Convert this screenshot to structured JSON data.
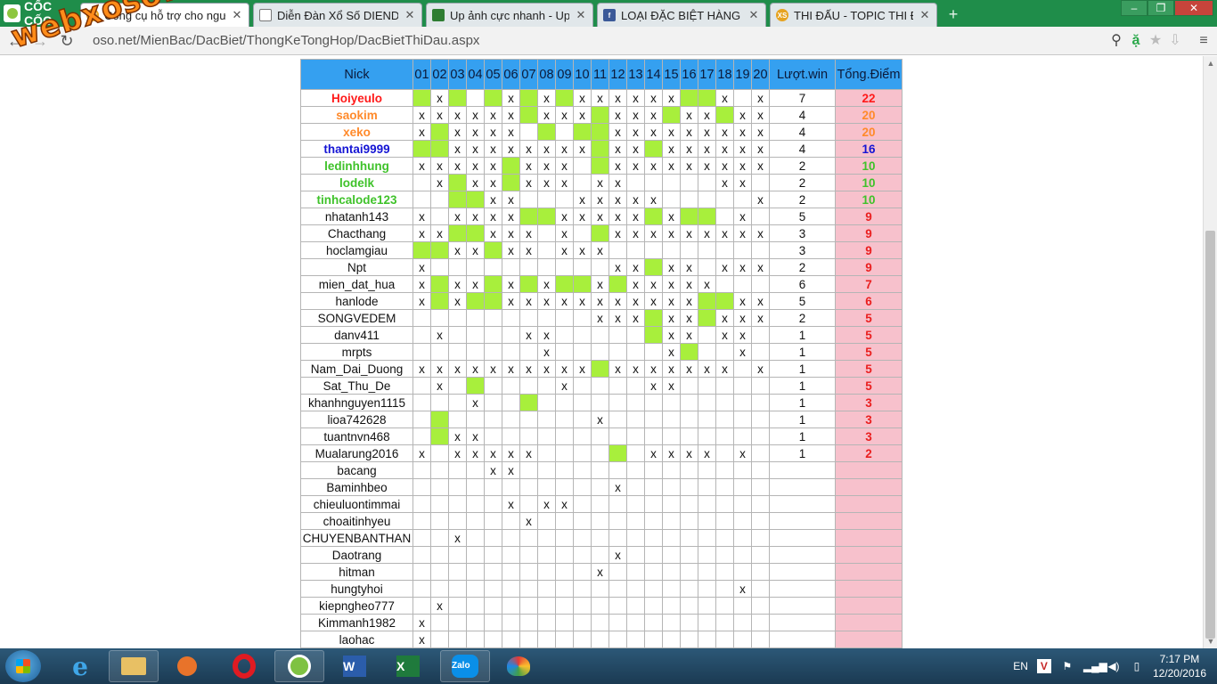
{
  "browser": {
    "brand": "CỐC CỐC",
    "tabs": [
      {
        "title": "Công cụ hỗ trợ cho người",
        "icon": "xs",
        "active": true
      },
      {
        "title": "Diễn Đàn Xổ Số DIENDAN",
        "icon": "doc",
        "active": false
      },
      {
        "title": "Up ảnh cực nhanh - Up hì",
        "icon": "img",
        "active": false
      },
      {
        "title": "LOẠI ĐẶC BIỆT HÀNG NGÀ",
        "icon": "fb",
        "active": false
      },
      {
        "title": "THI ĐẤU - TOPIC THI ĐẤU",
        "icon": "xs",
        "active": false
      }
    ],
    "url": "oso.net/MienBac/DacBiet/ThongKeTongHop/DacBietThiDau.aspx",
    "new_tab_label": "+",
    "window_controls": {
      "minimize": "–",
      "restore": "❐",
      "close": "✕"
    }
  },
  "watermark": "webxoso.net",
  "table": {
    "headers": {
      "nick": "Nick",
      "days": [
        "01",
        "02",
        "03",
        "04",
        "05",
        "06",
        "07",
        "08",
        "09",
        "10",
        "11",
        "12",
        "13",
        "14",
        "15",
        "16",
        "17",
        "18",
        "19",
        "20"
      ],
      "wins": "Lượt.win",
      "points": "Tổng.Điểm"
    },
    "rows": [
      {
        "nick": "Hoiyeulo",
        "color": "red",
        "cells": "GxG-GxGxGxxxxxxGGx-x",
        "wins": "7",
        "points": "22"
      },
      {
        "nick": "saokim",
        "color": "orange",
        "cells": "xxxxxxGxxxGxxxGxxGxx",
        "wins": "4",
        "points": "20"
      },
      {
        "nick": "xeko",
        "color": "orange",
        "cells": "xGxxxx-G-GGxxxxxxxxx",
        "wins": "4",
        "points": "20"
      },
      {
        "nick": "thantai9999",
        "color": "blue",
        "cells": "GGxxxxxxxxGxxGxxxxxx",
        "wins": "4",
        "points": "16"
      },
      {
        "nick": "ledinhhung",
        "color": "green",
        "cells": "xxxxxGxxx-Gxxxxxxxxx",
        "wins": "2",
        "points": "10"
      },
      {
        "nick": "lodelk",
        "color": "green",
        "cells": "-xGxxGxxx-xx-----xx-",
        "wins": "2",
        "points": "10"
      },
      {
        "nick": "tinhcalode123",
        "color": "green",
        "cells": "--GGxx---xxxxx-----x",
        "wins": "2",
        "points": "10"
      },
      {
        "nick": "nhatanh143",
        "color": "default",
        "cells": "x-xxxxGGxxxxxGxGG-x-",
        "wins": "5",
        "points": "9"
      },
      {
        "nick": "Chacthang",
        "color": "default",
        "cells": "xxGGxxx-x-Gxxxxxxxxx",
        "wins": "3",
        "points": "9"
      },
      {
        "nick": "hoclamgiau",
        "color": "default",
        "cells": "GGxxGxx-xxx---------",
        "wins": "3",
        "points": "9"
      },
      {
        "nick": "Npt",
        "color": "default",
        "cells": "x----------xxGxx-xxx",
        "wins": "2",
        "points": "9"
      },
      {
        "nick": "mien_dat_hua",
        "color": "default",
        "cells": "xGxxGxGxGGxGxxxxx---",
        "wins": "6",
        "points": "7"
      },
      {
        "nick": "hanlode",
        "color": "default",
        "cells": "xGxGGxxxxxxxxxxxGGxx",
        "wins": "5",
        "points": "6"
      },
      {
        "nick": "SONGVEDEM",
        "color": "default",
        "cells": "----------xxxGxxGxxx",
        "wins": "2",
        "points": "5"
      },
      {
        "nick": "danv411",
        "color": "default",
        "cells": "-x----xx-----Gxx-xx-",
        "wins": "1",
        "points": "5"
      },
      {
        "nick": "mrpts",
        "color": "default",
        "cells": "-------x------xG--x-",
        "wins": "1",
        "points": "5"
      },
      {
        "nick": "Nam_Dai_Duong",
        "color": "default",
        "cells": "xxxxxxxxxxGxxxxxxx-x",
        "wins": "1",
        "points": "5"
      },
      {
        "nick": "Sat_Thu_De",
        "color": "default",
        "cells": "-x-G----x----xx-----",
        "wins": "1",
        "points": "5"
      },
      {
        "nick": "khanhnguyen1115",
        "color": "default",
        "cells": "---x--G-------------",
        "wins": "1",
        "points": "3"
      },
      {
        "nick": "lioa742628",
        "color": "default",
        "cells": "-G--------x---------",
        "wins": "1",
        "points": "3"
      },
      {
        "nick": "tuantnvn468",
        "color": "default",
        "cells": "-Gxx----------------",
        "wins": "1",
        "points": "3"
      },
      {
        "nick": "Mualarung2016",
        "color": "default",
        "cells": "x-xxxxx----G-xxxx-x-",
        "wins": "1",
        "points": "2"
      },
      {
        "nick": "bacang",
        "color": "default",
        "cells": "----xx--------------",
        "wins": "",
        "points": ""
      },
      {
        "nick": "Baminhbeo",
        "color": "default",
        "cells": "-----------x--------",
        "wins": "",
        "points": ""
      },
      {
        "nick": "chieuluontimmai",
        "color": "default",
        "cells": "-----x-xx-----------",
        "wins": "",
        "points": ""
      },
      {
        "nick": "choaitinhyeu",
        "color": "default",
        "cells": "------x-------------",
        "wins": "",
        "points": ""
      },
      {
        "nick": "CHUYENBANTHAN",
        "color": "default",
        "cells": "--x-----------------",
        "wins": "",
        "points": ""
      },
      {
        "nick": "Daotrang",
        "color": "default",
        "cells": "-----------x--------",
        "wins": "",
        "points": ""
      },
      {
        "nick": "hitman",
        "color": "default",
        "cells": "----------x---------",
        "wins": "",
        "points": ""
      },
      {
        "nick": "hungtyhoi",
        "color": "default",
        "cells": "------------------x-",
        "wins": "",
        "points": ""
      },
      {
        "nick": "kiepngheo777",
        "color": "default",
        "cells": "-x------------------",
        "wins": "",
        "points": ""
      },
      {
        "nick": "Kimmanh1982",
        "color": "default",
        "cells": "x-------------------",
        "wins": "",
        "points": ""
      },
      {
        "nick": "laohac",
        "color": "default",
        "cells": "x-------------------",
        "wins": "",
        "points": ""
      }
    ]
  },
  "colors": {
    "header_bg": "#35a0f0",
    "hit_green": "#a8ef3c",
    "points_bg": "#f7c1cc",
    "red": "#ff1a1a",
    "orange": "#ff8a2b",
    "blue": "#1515d4",
    "green": "#3fc22a"
  },
  "taskbar": {
    "items": [
      "ie",
      "explorer",
      "media",
      "opera",
      "coccoc",
      "word",
      "excel",
      "zalo",
      "paint"
    ],
    "zalo_label": "Zalo",
    "lang": "EN",
    "time": "7:17 PM",
    "date": "12/20/2016"
  }
}
